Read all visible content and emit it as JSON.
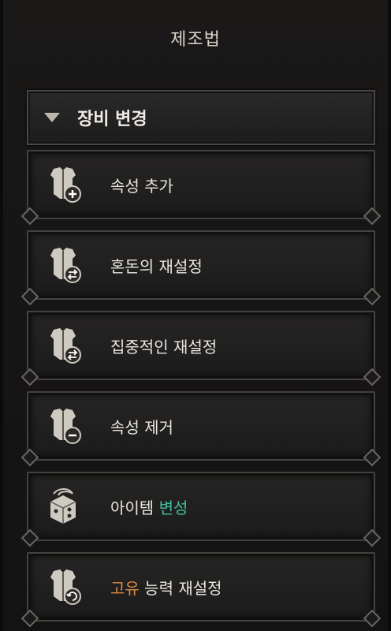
{
  "header": {
    "title": "제조법"
  },
  "section": {
    "label": "장비 변경"
  },
  "items": [
    {
      "label": "속성 추가",
      "icon": "armor-plus-icon"
    },
    {
      "label": "혼돈의 재설정",
      "icon": "armor-swap-icon"
    },
    {
      "label": "집중적인 재설정",
      "icon": "armor-swap-icon"
    },
    {
      "label": "속성 제거",
      "icon": "armor-minus-icon"
    },
    {
      "label_plain": "아이템 ",
      "label_highlight": "변성",
      "icon": "dice-icon"
    },
    {
      "label_highlight": "고유",
      "label_plain": " 능력 재설정",
      "icon": "armor-recycle-icon"
    }
  ],
  "colors": {
    "accent_green": "#3fc0a0",
    "accent_orange": "#d98a48"
  }
}
